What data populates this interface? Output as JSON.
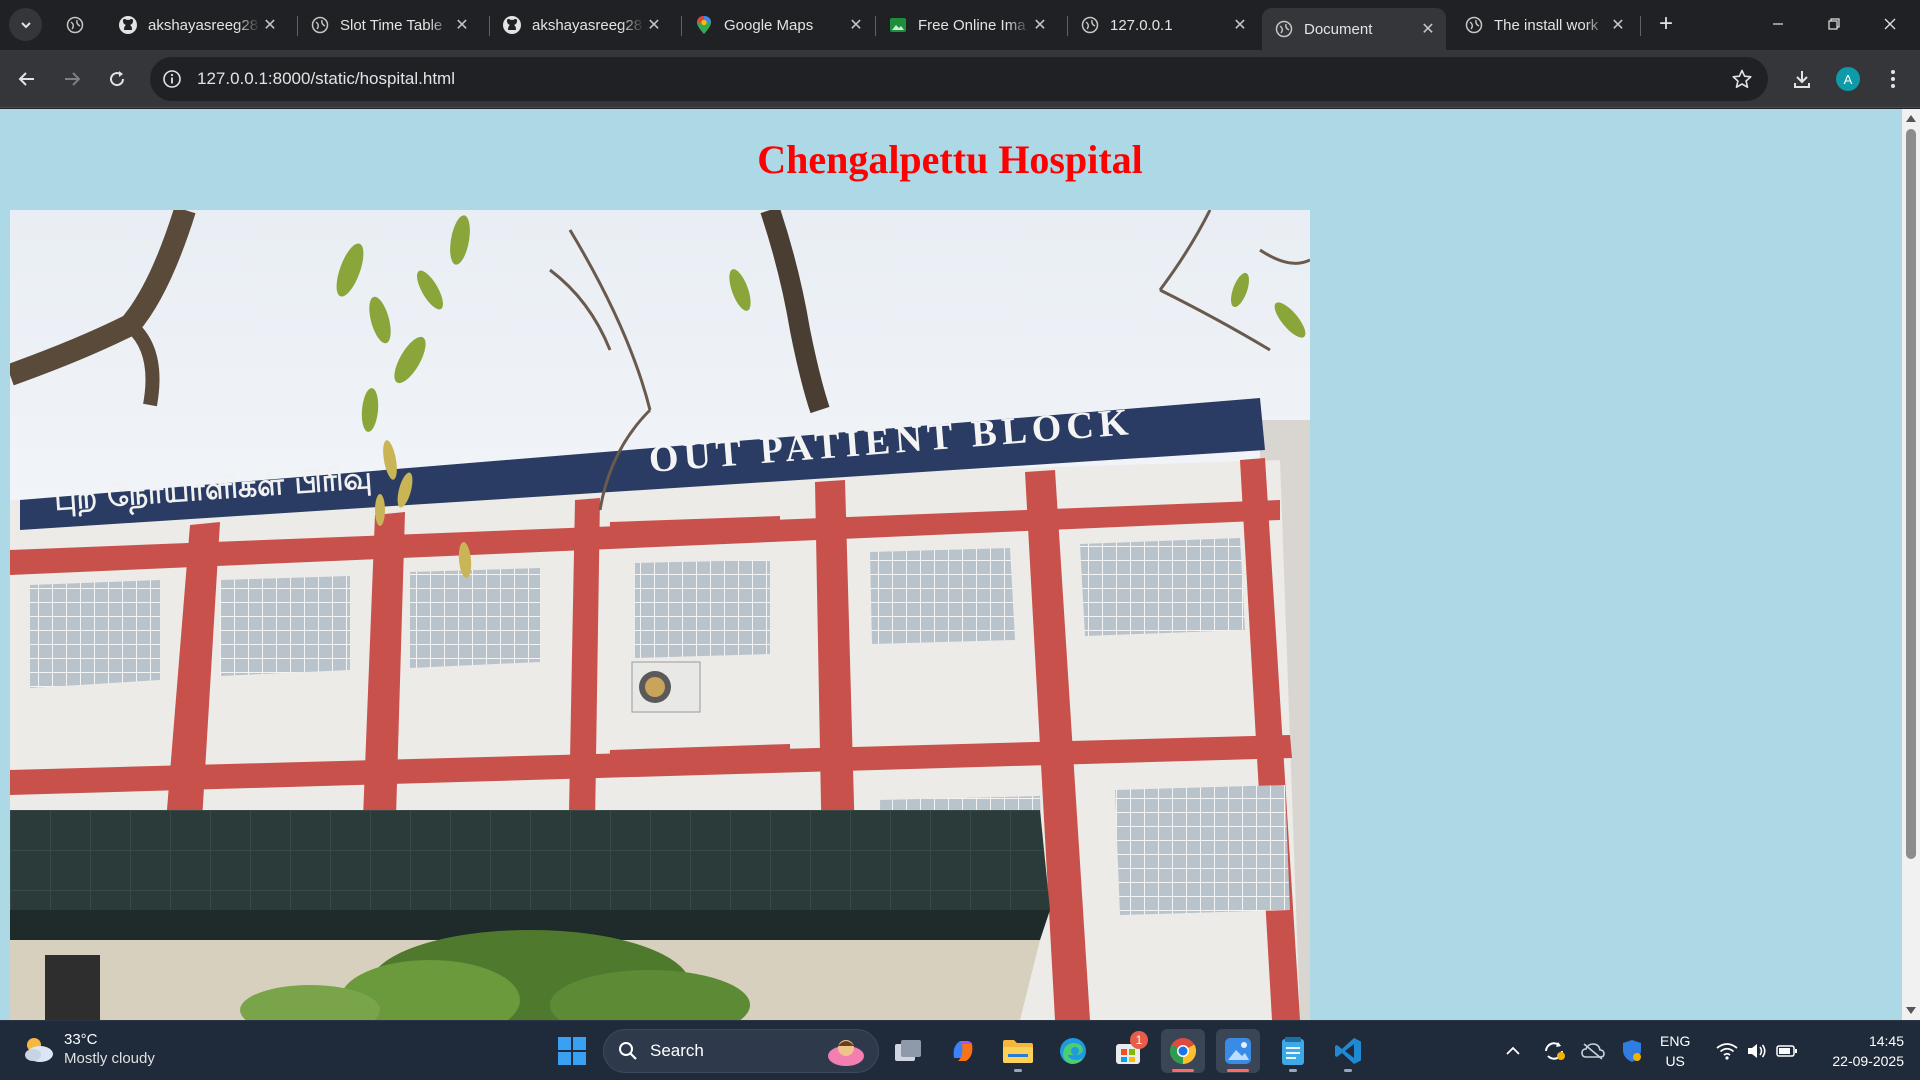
{
  "browser": {
    "tabs": [
      {
        "title": "akshayasreeg28",
        "favicon": "github-icon",
        "active": false
      },
      {
        "title": "Slot Time Table",
        "favicon": "globe-icon",
        "active": false
      },
      {
        "title": "akshayasreeg28",
        "favicon": "github-icon",
        "active": false
      },
      {
        "title": "Google Maps",
        "favicon": "maps-pin-icon",
        "active": false
      },
      {
        "title": "Free Online Ima",
        "favicon": "image-editor-icon",
        "active": false
      },
      {
        "title": "127.0.0.1",
        "favicon": "globe-icon",
        "active": false
      },
      {
        "title": "Document",
        "favicon": "globe-icon",
        "active": true
      },
      {
        "title": "The install work",
        "favicon": "globe-icon",
        "active": false
      }
    ],
    "address": "127.0.0.1:8000/static/hospital.html",
    "profile_initial": "A",
    "accent": "#0e9aa7"
  },
  "page": {
    "heading": "Chengalpettu Hospital",
    "heading_color": "#ff0000",
    "background_color": "#add8e6",
    "photo": {
      "sign_tamil": "புற நோயாளிகள் பிரிவு",
      "sign_english": "OUT PATIENT BLOCK"
    }
  },
  "taskbar": {
    "weather": {
      "temp": "33°C",
      "condition": "Mostly cloudy"
    },
    "search_label": "Search",
    "store_badge": "1",
    "language": {
      "line1": "ENG",
      "line2": "US"
    },
    "clock": {
      "time": "14:45",
      "date": "22-09-2025"
    }
  }
}
